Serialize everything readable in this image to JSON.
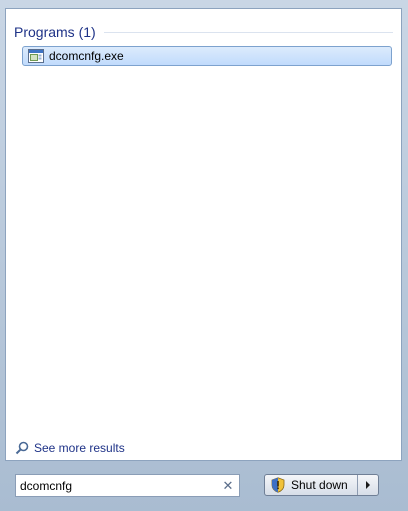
{
  "results": {
    "section_title": "Programs (1)",
    "items": [
      {
        "label": "dcomcnfg.exe",
        "icon": "app-window-icon"
      }
    ]
  },
  "see_more": {
    "label": "See more results",
    "icon": "search-icon"
  },
  "search": {
    "value": "dcomcnfg",
    "clear_icon": "close-icon"
  },
  "shutdown": {
    "label": "Shut down",
    "icon": "uac-shield-icon",
    "arrow_icon": "chevron-right-icon"
  },
  "colors": {
    "section_title": "#1e3287",
    "highlight": "#c1dbfc",
    "link": "#1e3287"
  }
}
